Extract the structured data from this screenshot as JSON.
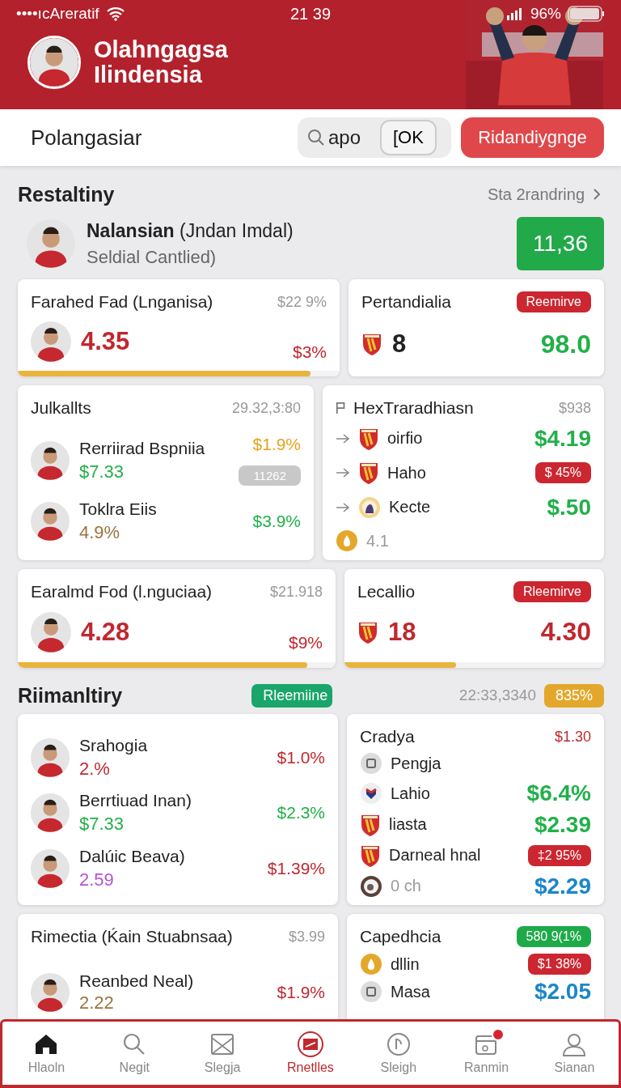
{
  "status_bar": {
    "carrier": "••••ıcAreratif",
    "time": "21 39",
    "battery": "96%"
  },
  "header": {
    "title": "Olahngagsa Ilindensia"
  },
  "toolbar": {
    "title": "Polangasiar",
    "search": {
      "value": "apo"
    },
    "toggle": "[OK",
    "button": "Ridandiygnge"
  },
  "sections": [
    {
      "title": "Restaltiny",
      "link": "Sta 2randring",
      "featured": {
        "name": "**Nalansian** (Jndan Imdal)",
        "subtitle": "Seldial Cantlied)",
        "score": "11,36"
      },
      "card_rows": [
        [
          {
            "kind": "stat",
            "title": "Farahed Fad (Lnganisa)",
            "meta": {
              "text": "$22 9%",
              "color": "#9a9a9a"
            },
            "level": 0.91,
            "rows": [
              {
                "kind": "avatar",
                "value": {
                  "text": "4.35",
                  "color": "#c0282f"
                },
                "end": {
                  "text": "$3%",
                  "color": "#c0282f",
                  "strong": false
                }
              }
            ]
          },
          {
            "kind": "stat",
            "title": "Pertandialia",
            "badge": {
              "text": "Reemirve",
              "color": "#cc2630"
            },
            "rows": [
              {
                "kind": "crest",
                "value": {
                  "text": "8",
                  "color": "#222222"
                },
                "end": {
                  "text": "98.0",
                  "color": "#22b04a",
                  "strong": true
                }
              }
            ]
          }
        ],
        [
          {
            "kind": "players",
            "title": "Julkallts",
            "meta": {
              "text": "29.32,3:80",
              "color": "#9a9a9a"
            },
            "rows": [
              {
                "kind": "avatar",
                "name": "Rerriirad Bspniia",
                "value": {
                  "text": "$7.33",
                  "color": "#22b04a"
                },
                "end": {
                  "text": "$1.9%",
                  "color": "#e8a21c",
                  "strong": false
                },
                "pill": "11262"
              },
              {
                "kind": "avatar",
                "name": "Toklra Eiis",
                "value": {
                  "text": "4.9%",
                  "color": "#9a7440"
                },
                "end": {
                  "text": "$3.9%",
                  "color": "#22b04a",
                  "strong": false
                }
              }
            ]
          },
          {
            "kind": "teams",
            "title": "HexTraradhiasn",
            "meta": {
              "text": "$938",
              "color": "#9a9a9a"
            },
            "rows": [
              {
                "arrow": true,
                "kind": "crest",
                "name": "oirfio",
                "end": {
                  "text": "$4.19",
                  "color": "#22b04a",
                  "strong": true
                }
              },
              {
                "arrow": true,
                "kind": "crest",
                "name": "Haho",
                "badge": {
                  "text": "$ 45%",
                  "color": "#cc2630"
                }
              },
              {
                "arrow": true,
                "kind": "emblem",
                "name": "Kecte",
                "end": {
                  "text": "$.50",
                  "color": "#22b04a",
                  "strong": true
                }
              },
              {
                "arrow": false,
                "kind": "coin",
                "value": {
                  "text": "4.1",
                  "color": "#9a9a9a"
                }
              }
            ]
          }
        ],
        [
          {
            "kind": "stat",
            "title": "Earalmd Fod (l.nguciaa)",
            "meta": {
              "text": "$21.918",
              "color": "#9a9a9a"
            },
            "level": 0.91,
            "rows": [
              {
                "kind": "avatar",
                "value": {
                  "text": "4.28",
                  "color": "#c0282f"
                },
                "end": {
                  "text": "$9%",
                  "color": "#c0282f",
                  "strong": false
                }
              }
            ]
          },
          {
            "kind": "stat",
            "title": "Lecallio",
            "badge": {
              "text": "Rleemirve",
              "color": "#cc2630"
            },
            "level": 0.43,
            "rows": [
              {
                "kind": "crest",
                "value": {
                  "text": "18",
                  "color": "#c0282f"
                },
                "end": {
                  "text": "4.30",
                  "color": "#c0282f",
                  "strong": true
                }
              }
            ]
          }
        ]
      ]
    },
    {
      "title": "Riimanltiry",
      "badge": {
        "text": "Rleemiine",
        "color": "#1aa56a"
      },
      "meta": "22:33,3340",
      "score_badge": {
        "text": "835%",
        "color": "#e3a82b"
      },
      "card_rows": [
        [
          {
            "kind": "players",
            "rows": [
              {
                "kind": "avatar",
                "name": "Srahogia",
                "value": {
                  "text": "2.%",
                  "color": "#c0282f"
                },
                "end": {
                  "text": "$1.0%",
                  "color": "#c0282f",
                  "strong": false
                }
              },
              {
                "kind": "avatar",
                "name": "Berrtiuad Inan)",
                "value": {
                  "text": "$7.33",
                  "color": "#22b04a"
                },
                "end": {
                  "text": "$2.3%",
                  "color": "#22b04a",
                  "strong": false
                }
              },
              {
                "kind": "avatar",
                "name": "Dalúic Beava)",
                "value": {
                  "text": "2.59",
                  "color": "#b552d6"
                },
                "end": {
                  "text": "$1.39%",
                  "color": "#c0282f",
                  "strong": false
                }
              }
            ]
          },
          {
            "kind": "teams",
            "title": "Cradya",
            "meta": {
              "text": "$1.30",
              "color": "#c0282f"
            },
            "rows": [
              {
                "arrow": false,
                "kind": "disc",
                "name": "Pengja"
              },
              {
                "arrow": false,
                "kind": "ball",
                "name": "Lahio",
                "end": {
                  "text": "$6.4%",
                  "color": "#22b04a",
                  "strong": true
                }
              },
              {
                "arrow": false,
                "kind": "crest",
                "name": "liasta",
                "end": {
                  "text": "$2.39",
                  "color": "#22b04a",
                  "strong": true
                }
              },
              {
                "arrow": false,
                "kind": "crest",
                "name": "Darneal hnal",
                "badge": {
                  "text": "‡2 95%",
                  "color": "#cc2630"
                }
              },
              {
                "arrow": false,
                "kind": "ring",
                "value": {
                  "text": "0 ch",
                  "color": "#9a9a9a"
                },
                "end": {
                  "text": "$2.29",
                  "color": "#1b86c9",
                  "strong": true
                }
              }
            ]
          }
        ],
        [
          {
            "kind": "players",
            "title": "Rimectia (Ḱain Stuabnsaa)",
            "meta": {
              "text": "$3.99",
              "color": "#9a9a9a"
            },
            "rows": [
              {
                "kind": "avatar",
                "name": "Reanbed Neal)",
                "value": {
                  "text": "2.22",
                  "color": "#9a7440"
                },
                "end": {
                  "text": "$1.9%",
                  "color": "#c0282f",
                  "strong": false
                }
              }
            ]
          },
          {
            "kind": "teams",
            "title": "Capedhcia",
            "badge": {
              "text": "580 9(1%",
              "color": "#1faa4a"
            },
            "rows": [
              {
                "arrow": false,
                "kind": "coin",
                "name": "dllin",
                "badge": {
                  "text": "$1 38%",
                  "color": "#cc2630"
                }
              },
              {
                "arrow": false,
                "kind": "disc",
                "name": "Masa",
                "end": {
                  "text": "$2.05",
                  "color": "#1b86c9",
                  "strong": true
                }
              }
            ]
          }
        ]
      ]
    }
  ],
  "nav": {
    "items": [
      {
        "label": "Hlaoln",
        "selected": false,
        "alert": false
      },
      {
        "label": "Negit",
        "selected": false,
        "alert": false
      },
      {
        "label": "Slegja",
        "selected": false,
        "alert": false
      },
      {
        "label": "Rnetlles",
        "selected": true,
        "alert": false
      },
      {
        "label": "Sleigh",
        "selected": false,
        "alert": false
      },
      {
        "label": "Ranmin",
        "selected": false,
        "alert": true
      },
      {
        "label": "Sianan",
        "selected": false,
        "alert": false
      }
    ]
  }
}
